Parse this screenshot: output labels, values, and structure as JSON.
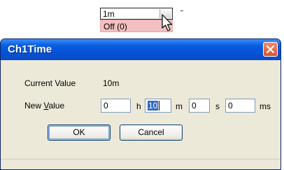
{
  "dropdown": {
    "current_value": "1m",
    "highlighted_option": "Off (0)"
  },
  "dialog": {
    "title": "Ch1Time",
    "current_value_label": "Current Value",
    "current_value": "10m",
    "new_value_label_pre": "New ",
    "new_value_label_access": "V",
    "new_value_label_post": "alue",
    "hours_value": "0",
    "hours_unit": "h",
    "minutes_value": "10",
    "minutes_unit": "m",
    "seconds_value": "0",
    "seconds_unit": "s",
    "ms_value": "0",
    "ms_unit": "ms",
    "ok_label": "OK",
    "cancel_label": "Cancel"
  },
  "colors": {
    "titlebar": "#0a5ee0",
    "window_bg": "#ece9d8",
    "highlight_option": "#f3bfc0",
    "selection": "#316ac5",
    "close_button": "#d9532d"
  },
  "icons": {
    "close": "close-icon",
    "cursor": "mouse-pointer-icon"
  }
}
